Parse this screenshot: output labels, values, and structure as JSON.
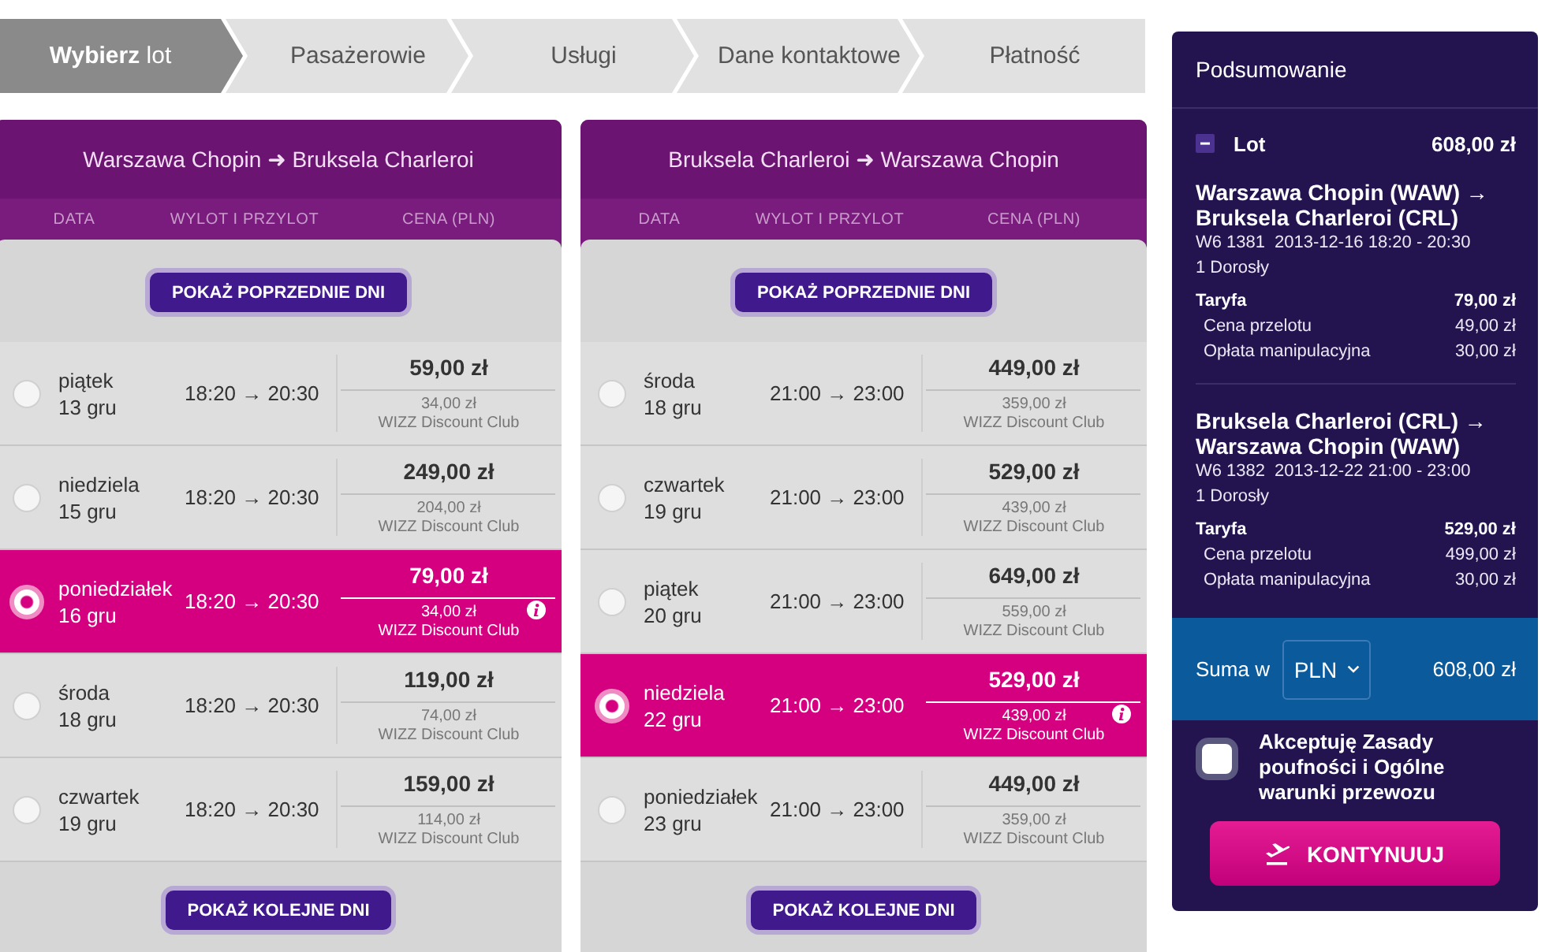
{
  "steps": [
    {
      "label": "**Wybierz** lot",
      "selected": true
    },
    {
      "label": "Pasażerowie",
      "selected": false
    },
    {
      "label": "Usługi",
      "selected": false
    },
    {
      "label": "Dane kontaktowe",
      "selected": false
    },
    {
      "label": "Płatność",
      "selected": false
    }
  ],
  "flights": [
    {
      "route": "Warszawa Chopin ➜ Bruksela Charleroi",
      "columns": [
        "DATA",
        "WYLOT I PRZYLOT",
        "CENA (PLN)"
      ],
      "prev_button": "POKAŻ POPRZEDNIE DNI",
      "rows": [
        {
          "day": "piątek",
          "date": "13 gru",
          "times": "18:20 → 20:30",
          "price": "59,00 zł",
          "club_price": "34,00 zł",
          "club_label": "WIZZ Discount Club",
          "selected": false
        },
        {
          "day": "niedziela",
          "date": "15 gru",
          "times": "18:20 → 20:30",
          "price": "249,00 zł",
          "club_price": "204,00 zł",
          "club_label": "WIZZ Discount Club",
          "selected": false
        },
        {
          "day": "poniedziałek",
          "date": "16 gru",
          "times": "18:20 → 20:30",
          "price": "79,00 zł",
          "club_price": "34,00 zł",
          "club_label": "WIZZ Discount Club",
          "selected": true
        },
        {
          "day": "środa",
          "date": "18 gru",
          "times": "18:20 → 20:30",
          "price": "119,00 zł",
          "club_price": "74,00 zł",
          "club_label": "WIZZ Discount Club",
          "selected": false
        },
        {
          "day": "czwartek",
          "date": "19 gru",
          "times": "18:20 → 20:30",
          "price": "159,00 zł",
          "club_price": "114,00 zł",
          "club_label": "WIZZ Discount Club",
          "selected": false
        }
      ],
      "next_button": "POKAŻ KOLEJNE DNI"
    },
    {
      "route": "Bruksela Charleroi ➜ Warszawa Chopin",
      "columns": [
        "DATA",
        "WYLOT I PRZYLOT",
        "CENA (PLN)"
      ],
      "prev_button": "POKAŻ POPRZEDNIE DNI",
      "rows": [
        {
          "day": "środa",
          "date": "18 gru",
          "times": "21:00 → 23:00",
          "price": "449,00 zł",
          "club_price": "359,00 zł",
          "club_label": "WIZZ Discount Club",
          "selected": false
        },
        {
          "day": "czwartek",
          "date": "19 gru",
          "times": "21:00 → 23:00",
          "price": "529,00 zł",
          "club_price": "439,00 zł",
          "club_label": "WIZZ Discount Club",
          "selected": false
        },
        {
          "day": "piątek",
          "date": "20 gru",
          "times": "21:00 → 23:00",
          "price": "649,00 zł",
          "club_price": "559,00 zł",
          "club_label": "WIZZ Discount Club",
          "selected": false
        },
        {
          "day": "niedziela",
          "date": "22 gru",
          "times": "21:00 → 23:00",
          "price": "529,00 zł",
          "club_price": "439,00 zł",
          "club_label": "WIZZ Discount Club",
          "selected": true
        },
        {
          "day": "poniedziałek",
          "date": "23 gru",
          "times": "21:00 → 23:00",
          "price": "449,00 zł",
          "club_price": "359,00 zł",
          "club_label": "WIZZ Discount Club",
          "selected": false
        }
      ],
      "next_button": "POKAŻ KOLEJNE DNI"
    }
  ],
  "summary": {
    "title": "Podsumowanie",
    "section": {
      "label": "Lot",
      "amount": "608,00 zł",
      "expanded": true
    },
    "legs": [
      {
        "route": "Warszawa Chopin (WAW) → Bruksela Charleroi (CRL)",
        "flight_number": "W6 1381",
        "schedule": "2013-12-16 18:20 - 20:30",
        "passengers": "1 Dorosły",
        "fare": {
          "label": "Taryfa",
          "amount": "79,00 zł"
        },
        "fees": [
          {
            "label": "Cena przelotu",
            "amount": "49,00 zł"
          },
          {
            "label": "Opłata manipulacyjna",
            "amount": "30,00 zł"
          }
        ]
      },
      {
        "route": "Bruksela Charleroi (CRL) → Warszawa Chopin (WAW)",
        "flight_number": "W6 1382",
        "schedule": "2013-12-22 21:00 - 23:00",
        "passengers": "1 Dorosły",
        "fare": {
          "label": "Taryfa",
          "amount": "529,00 zł"
        },
        "fees": [
          {
            "label": "Cena przelotu",
            "amount": "499,00 zł"
          },
          {
            "label": "Opłata manipulacyjna",
            "amount": "30,00 zł"
          }
        ]
      }
    ],
    "total": {
      "label": "Suma w",
      "currency": "PLN",
      "amount": "608,00 zł"
    },
    "terms": {
      "text": "Akceptuję Zasady poufności i Ogólne warunki przewozu",
      "checked": false
    },
    "continue_button": "KONTYNUUJ"
  }
}
